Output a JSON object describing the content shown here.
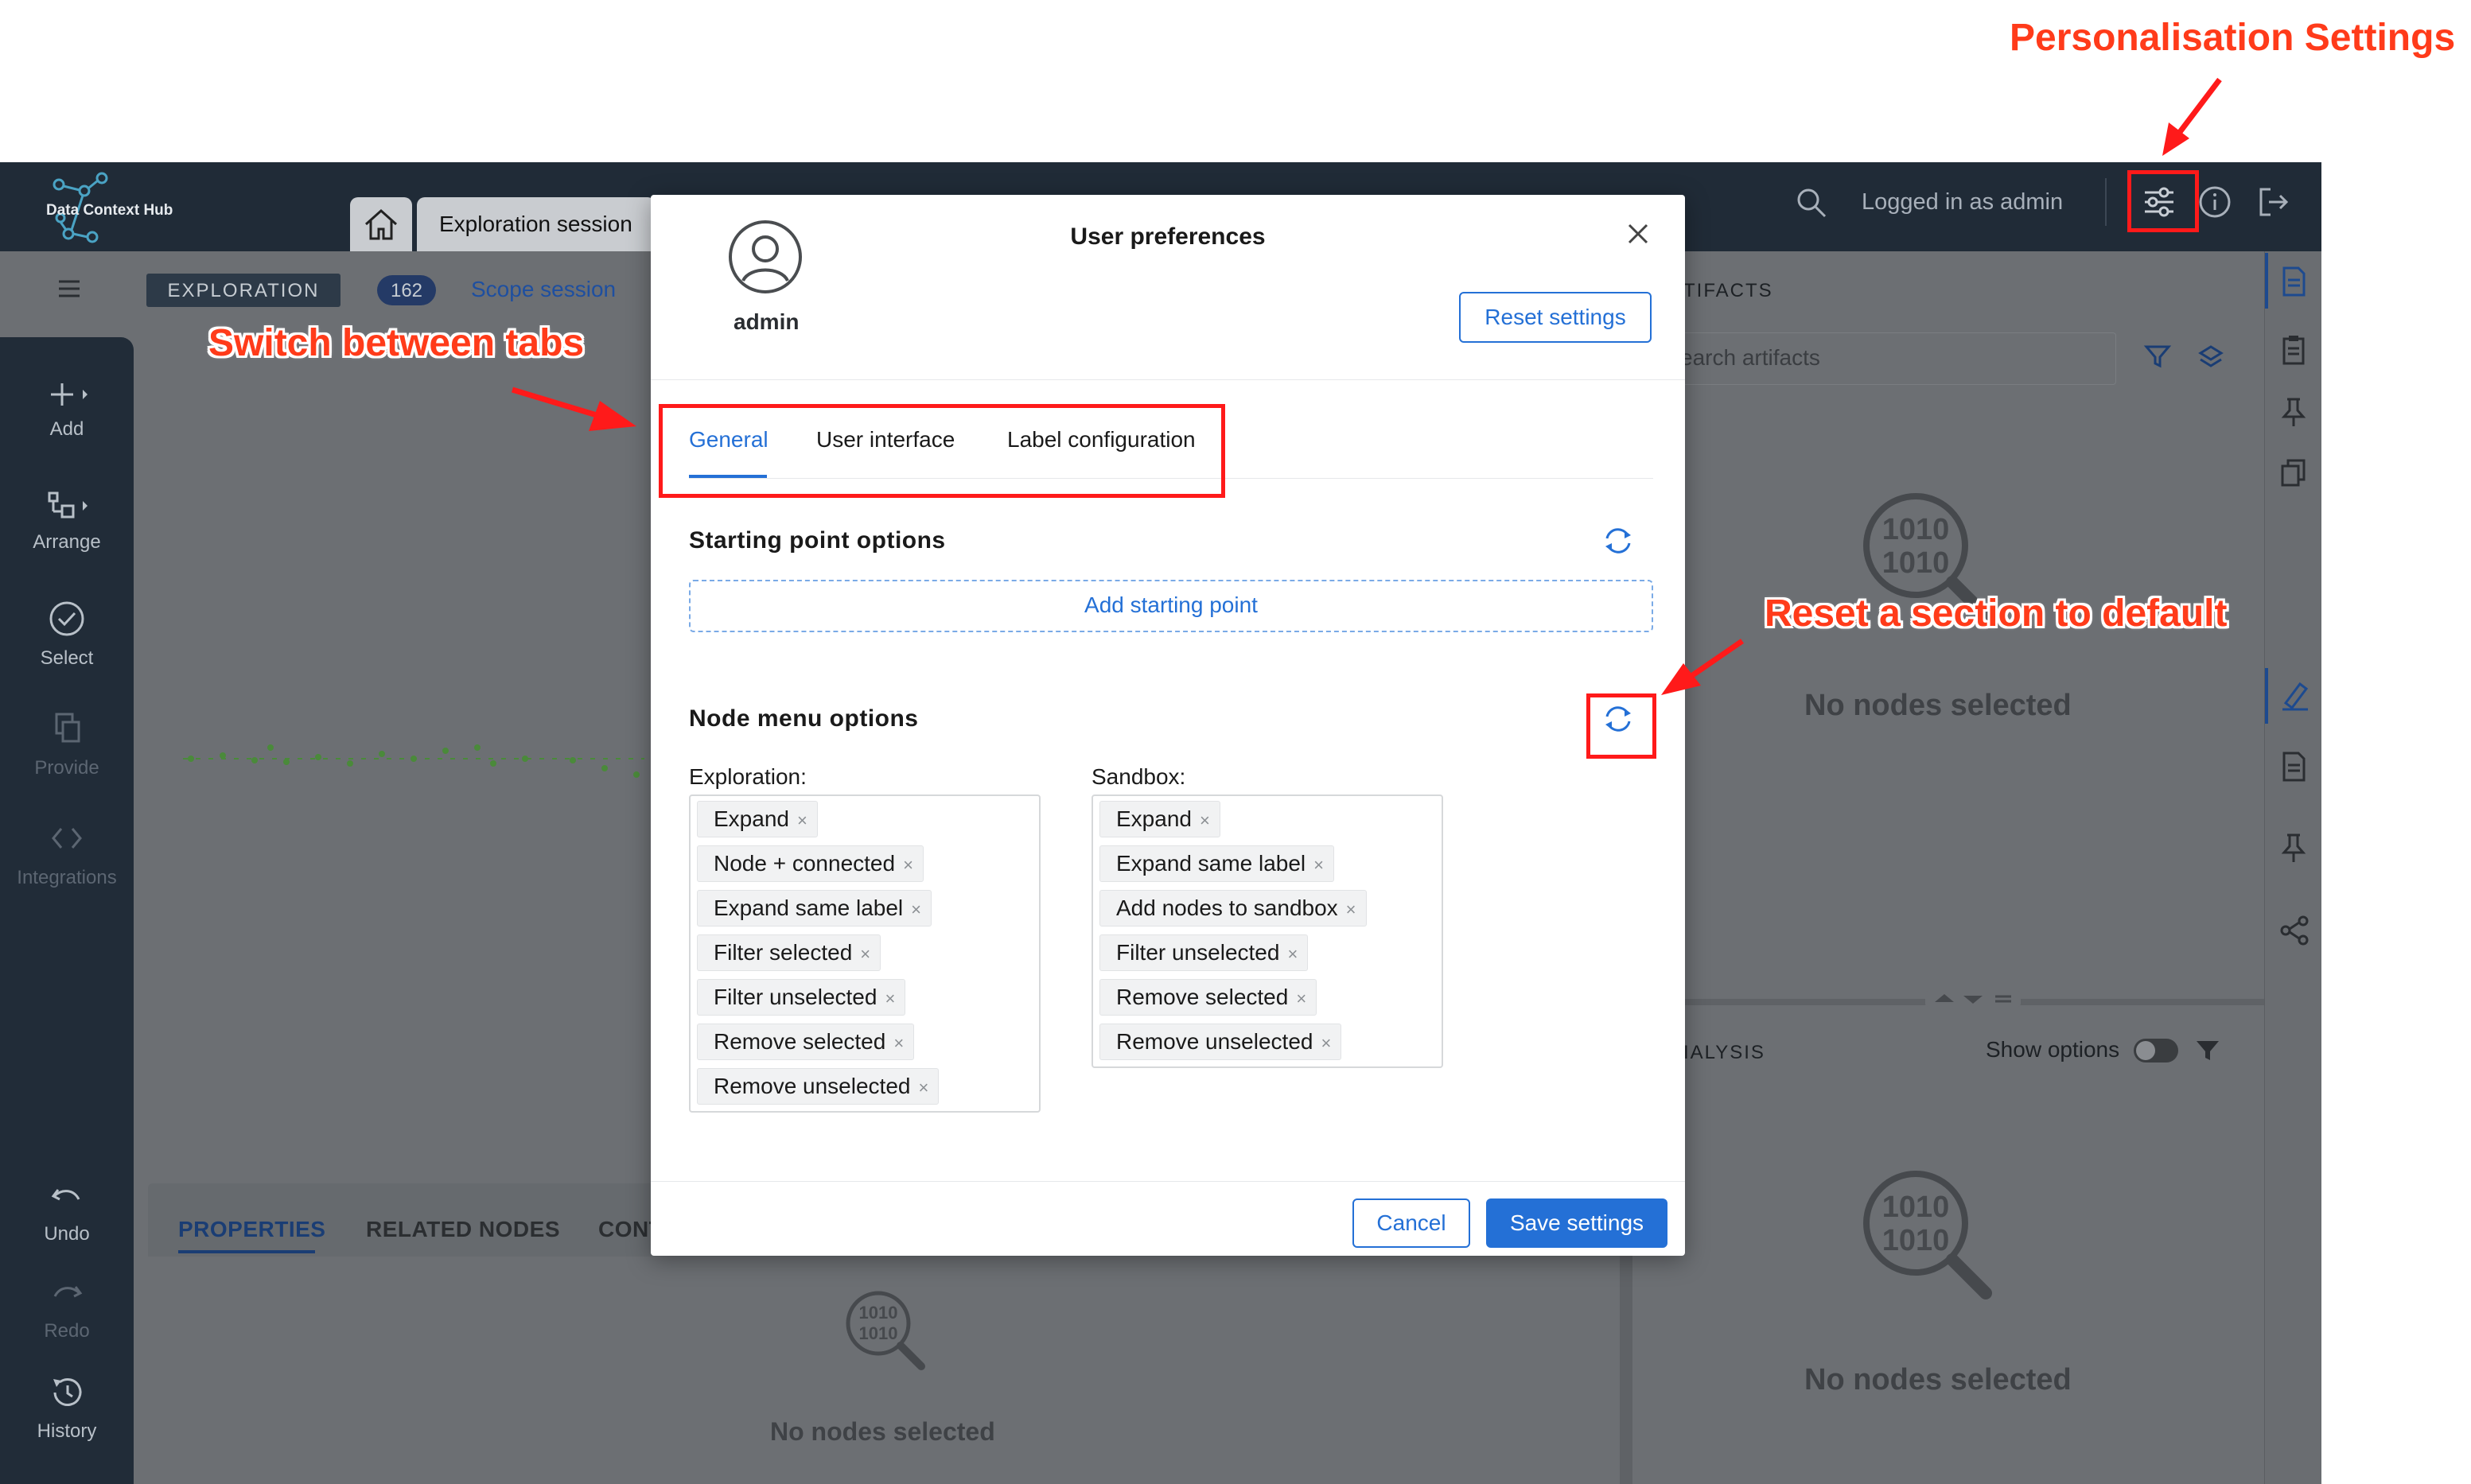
{
  "app": {
    "logo_text": "Data Context Hub",
    "session_tab": "Exploration session",
    "logged_in": "Logged in as admin",
    "mode_badge": "EXPLORATION",
    "count_badge": "162",
    "scope_link": "Scope session",
    "artifacts_title": "TIFACTS",
    "search_artifacts_placeholder": "earch artifacts",
    "no_nodes_selected": "No nodes selected",
    "analysis_title": "IALYSIS",
    "show_options": "Show options",
    "binary_lines": [
      "1010",
      "1010"
    ]
  },
  "sidebar": {
    "items": [
      {
        "label": "Add",
        "icon": "plus-icon"
      },
      {
        "label": "Arrange",
        "icon": "arrange-icon"
      },
      {
        "label": "Select",
        "icon": "check-circle-icon"
      },
      {
        "label": "Provide",
        "icon": "copy-icon"
      },
      {
        "label": "Integrations",
        "icon": "code-icon"
      },
      {
        "label": "Undo",
        "icon": "undo-icon"
      },
      {
        "label": "Redo",
        "icon": "redo-icon"
      },
      {
        "label": "History",
        "icon": "history-icon"
      }
    ]
  },
  "bottom_panel": {
    "tabs": [
      "PROPERTIES",
      "RELATED NODES",
      "CONT"
    ],
    "empty_text": "No nodes selected"
  },
  "modal": {
    "title": "User preferences",
    "username": "admin",
    "reset_settings": "Reset settings",
    "tabs": [
      "General",
      "User interface",
      "Label configuration"
    ],
    "starting_point_title": "Starting point options",
    "add_starting_point": "Add starting point",
    "node_menu_title": "Node menu options",
    "exploration_label": "Exploration:",
    "exploration_items": [
      "Expand",
      "Node + connected",
      "Expand same label",
      "Filter selected",
      "Filter unselected",
      "Remove selected",
      "Remove unselected"
    ],
    "sandbox_label": "Sandbox:",
    "sandbox_items": [
      "Expand",
      "Expand same label",
      "Add nodes to sandbox",
      "Filter unselected",
      "Remove selected",
      "Remove unselected"
    ],
    "cancel": "Cancel",
    "save": "Save settings",
    "tag_remove_glyph": "×"
  },
  "annotations": {
    "personalisation": "Personalisation Settings",
    "switch_tabs": "Switch between tabs",
    "reset_section": "Reset a section to default"
  },
  "colors": {
    "accent": "#2470d6",
    "annotation": "#ff1a1a",
    "topbar": "#202b37",
    "overlay": "#6c6f73"
  }
}
